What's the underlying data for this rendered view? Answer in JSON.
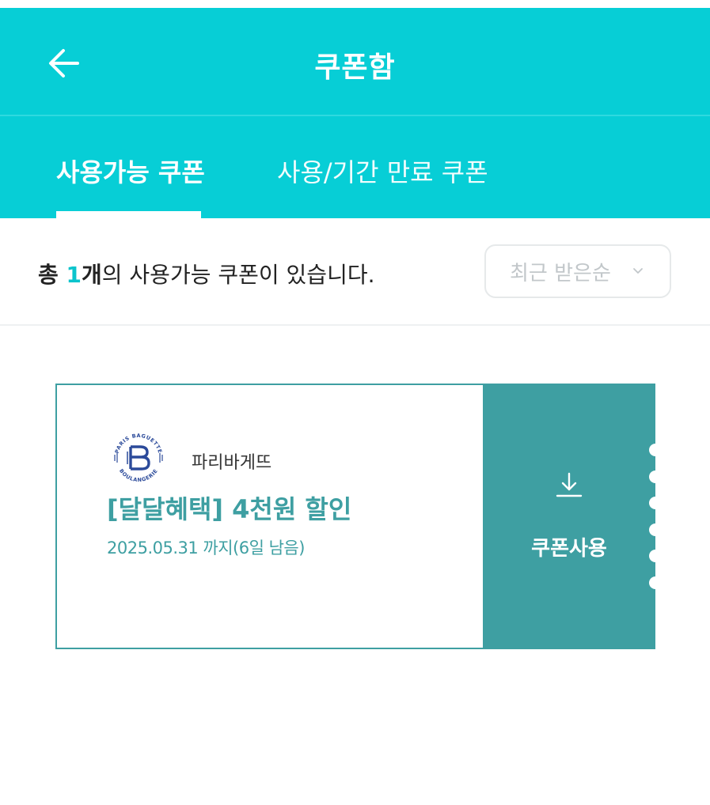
{
  "header": {
    "title": "쿠폰함",
    "back_icon": "arrow-left-icon"
  },
  "tabs": [
    {
      "label": "사용가능 쿠폰",
      "active": true
    },
    {
      "label": "사용/기간 만료 쿠폰",
      "active": false
    }
  ],
  "summary": {
    "prefix": "총 ",
    "count": "1",
    "unit": "개",
    "suffix": "의 사용가능 쿠폰이 있습니다."
  },
  "sort": {
    "selected": "최근 받은순",
    "icon": "chevron-down-icon"
  },
  "coupon": {
    "brand": "파리바게뜨",
    "brand_logo_text_top": "PARIS BAGUETTE",
    "brand_logo_text_bottom": "BOULANGERIE",
    "title": "[달달혜택] 4천원 할인",
    "expiry": "2025.05.31 까지(6일 남음)",
    "action_label": "쿠폰사용",
    "action_icon": "download-icon"
  },
  "colors": {
    "header_bg": "#07ced6",
    "accent": "#3e9fa2",
    "count_highlight": "#0bc4cc"
  }
}
